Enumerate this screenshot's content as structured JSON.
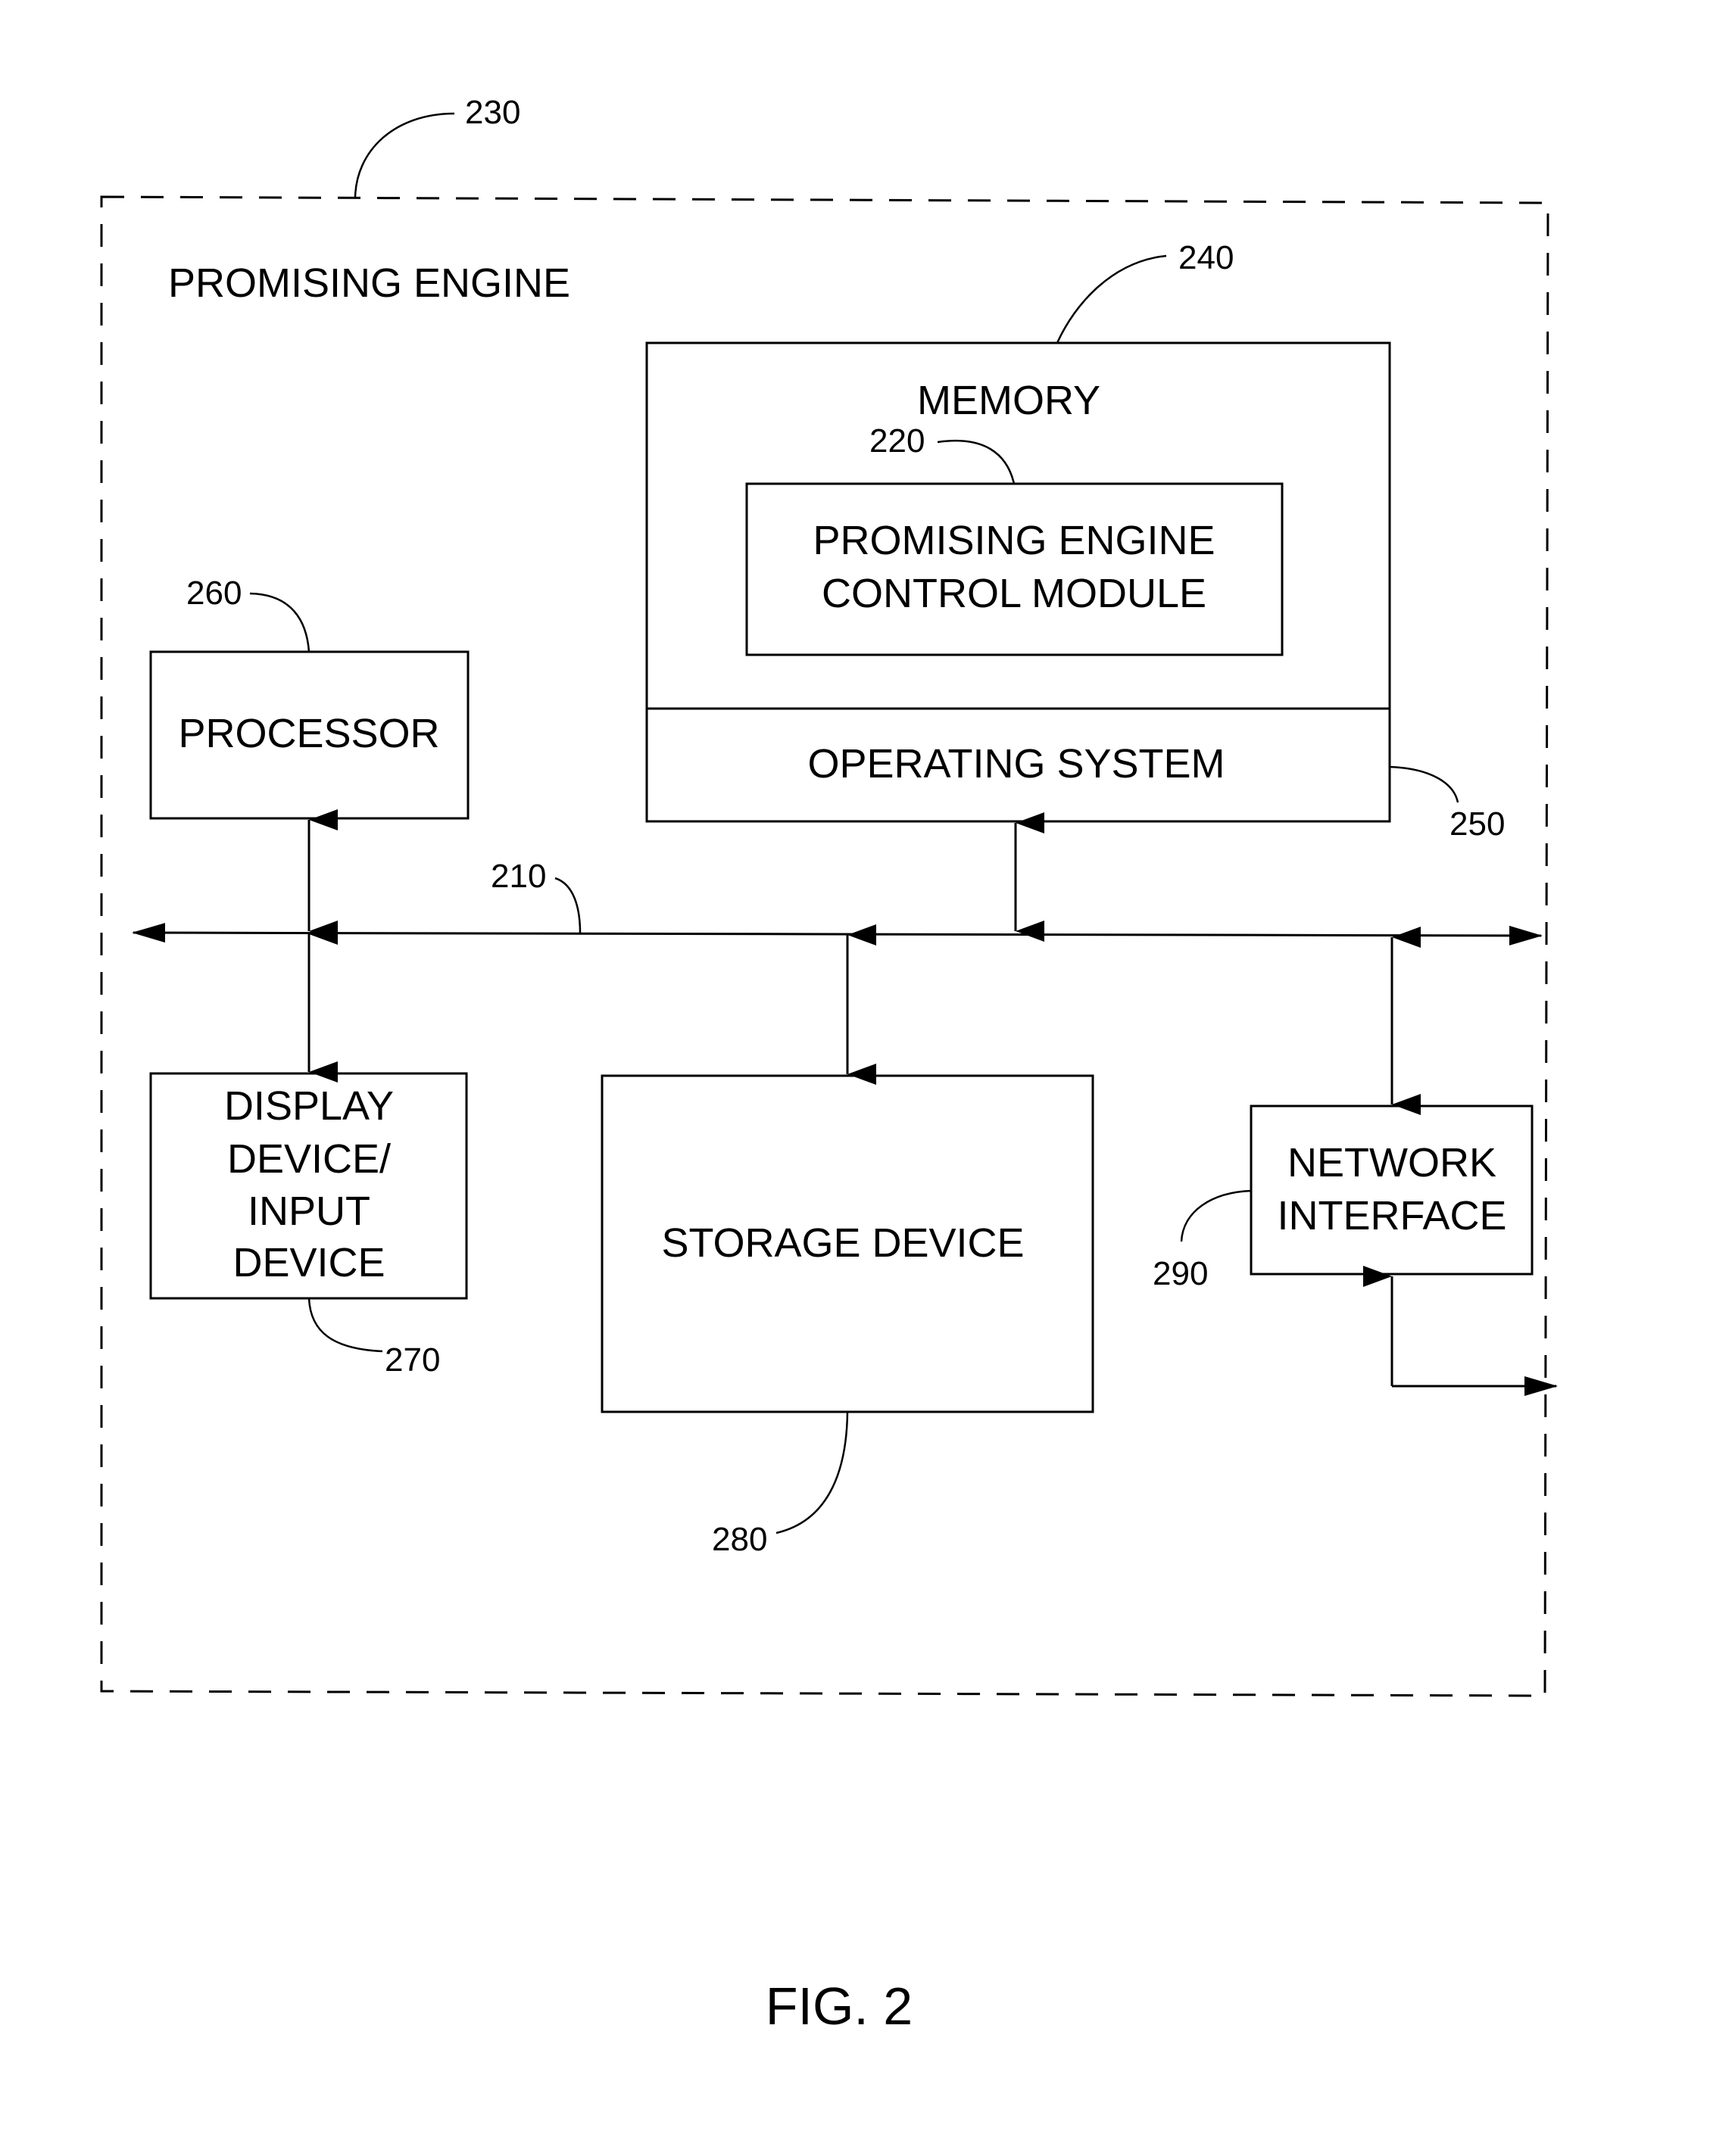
{
  "figure": {
    "caption": "FIG. 2",
    "container": {
      "label": "PROMISING ENGINE",
      "ref": "230"
    },
    "bus": {
      "ref": "210"
    },
    "memory": {
      "label": "MEMORY",
      "ref": "240",
      "module": {
        "lines": [
          "PROMISING ENGINE",
          "CONTROL MODULE"
        ],
        "ref": "220"
      },
      "operating_system": {
        "label": "OPERATING SYSTEM",
        "ref": "250"
      }
    },
    "processor": {
      "label": "PROCESSOR",
      "ref": "260"
    },
    "display": {
      "lines": [
        "DISPLAY",
        "DEVICE/",
        "INPUT",
        "DEVICE"
      ],
      "ref": "270"
    },
    "storage": {
      "label": "STORAGE DEVICE",
      "ref": "280"
    },
    "network": {
      "lines": [
        "NETWORK",
        "INTERFACE"
      ],
      "ref": "290"
    }
  }
}
